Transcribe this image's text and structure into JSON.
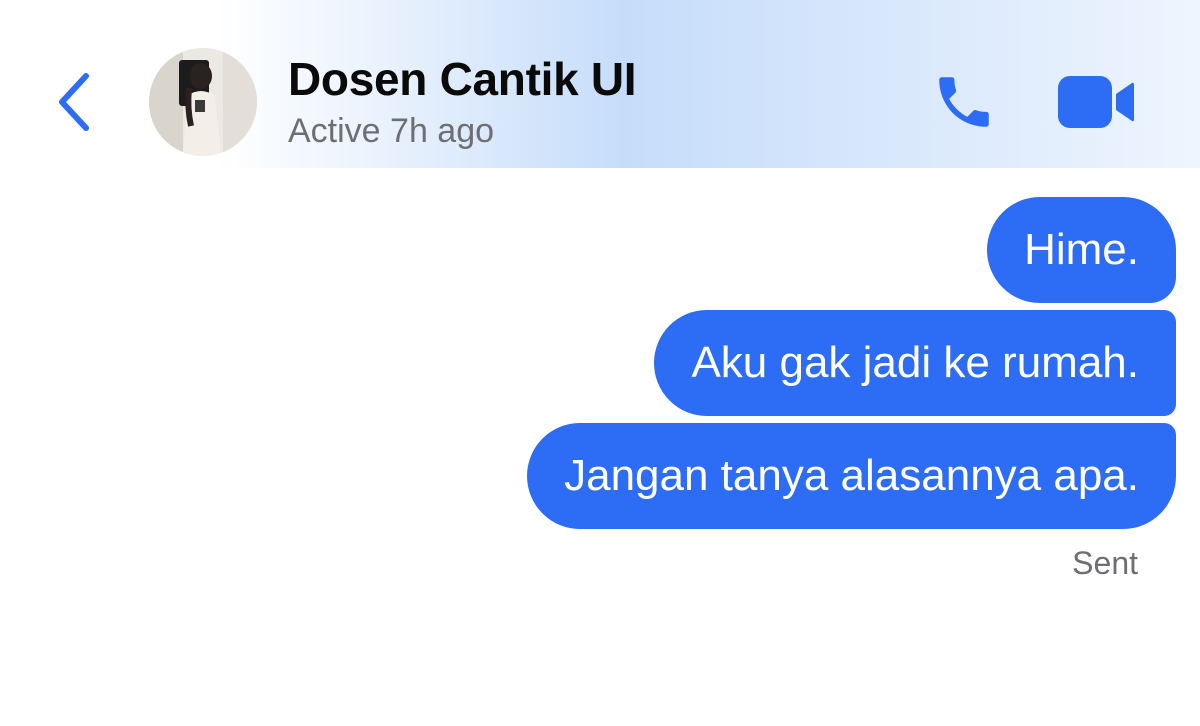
{
  "header": {
    "contact_name": "Dosen Cantik UI",
    "status": "Active 7h ago",
    "back_icon": "chevron-left-icon",
    "call_icon": "phone-icon",
    "video_icon": "video-camera-icon"
  },
  "messages": [
    {
      "text": "Hime.",
      "direction": "outgoing"
    },
    {
      "text": "Aku gak jadi ke rumah.",
      "direction": "outgoing"
    },
    {
      "text": "Jangan tanya alasannya apa.",
      "direction": "outgoing"
    }
  ],
  "delivery_status": "Sent",
  "colors": {
    "accent": "#2d6cf5",
    "bubble_text": "#ffffff",
    "secondary_text": "#6e6e73"
  }
}
